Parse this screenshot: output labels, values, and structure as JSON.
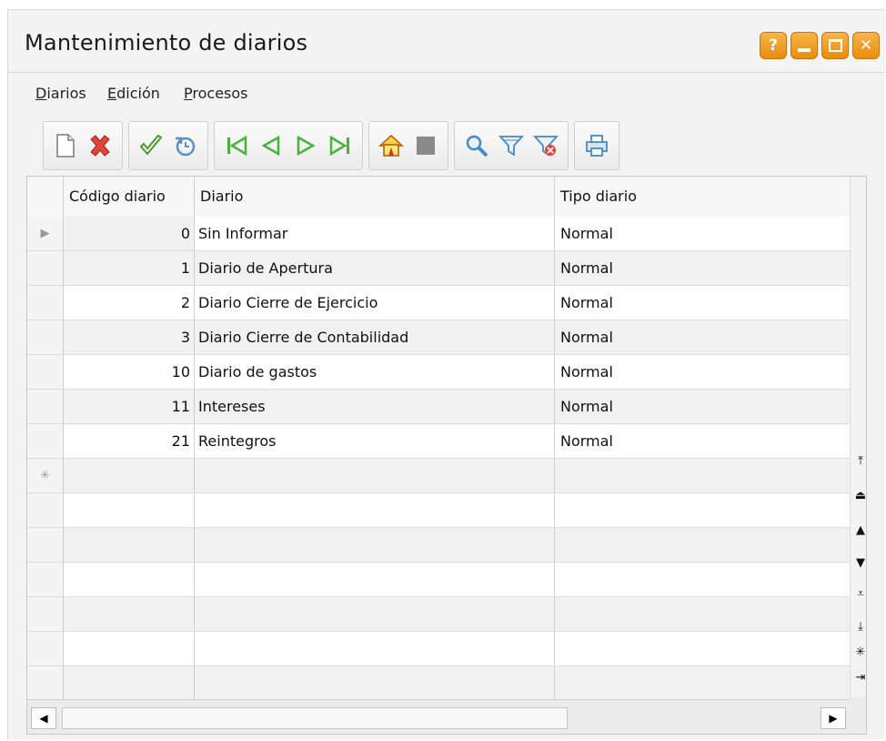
{
  "window": {
    "title": "Mantenimiento de diarios",
    "buttons": {
      "help": "?",
      "close": "✕"
    }
  },
  "menu": [
    "Diarios",
    "Edición",
    "Procesos"
  ],
  "toolbar": {
    "groups": [
      [
        "new-icon",
        "delete-icon"
      ],
      [
        "accept-icon",
        "undo-icon"
      ],
      [
        "first-record-icon",
        "previous-record-icon",
        "next-record-icon",
        "last-record-icon"
      ],
      [
        "home-icon",
        "stop-icon"
      ],
      [
        "search-icon",
        "filter-icon",
        "clear-filter-icon"
      ],
      [
        "print-icon"
      ]
    ]
  },
  "grid": {
    "columns": [
      "Código diario",
      "Diario",
      "Tipo diario"
    ],
    "rows": [
      {
        "code": "0",
        "name": "Sin Informar",
        "type": "Normal"
      },
      {
        "code": "1",
        "name": "Diario de Apertura",
        "type": "Normal"
      },
      {
        "code": "2",
        "name": "Diario Cierre de Ejercicio",
        "type": "Normal"
      },
      {
        "code": "3",
        "name": "Diario Cierre de Contabilidad",
        "type": "Normal"
      },
      {
        "code": "10",
        "name": "Diario de gastos",
        "type": "Normal"
      },
      {
        "code": "11",
        "name": "Intereses",
        "type": "Normal"
      },
      {
        "code": "21",
        "name": "Reintegros",
        "type": "Normal"
      }
    ],
    "empty_rows": 7,
    "current_row_marker": "▶",
    "new_row_marker": "✳"
  },
  "navigator": [
    "⤒",
    "⏏",
    "▲",
    "▼",
    "⩡",
    "⤓",
    "✳",
    "⇥"
  ],
  "colors": {
    "accent": "#f0a020",
    "grid_line": "#d0d0d0"
  }
}
